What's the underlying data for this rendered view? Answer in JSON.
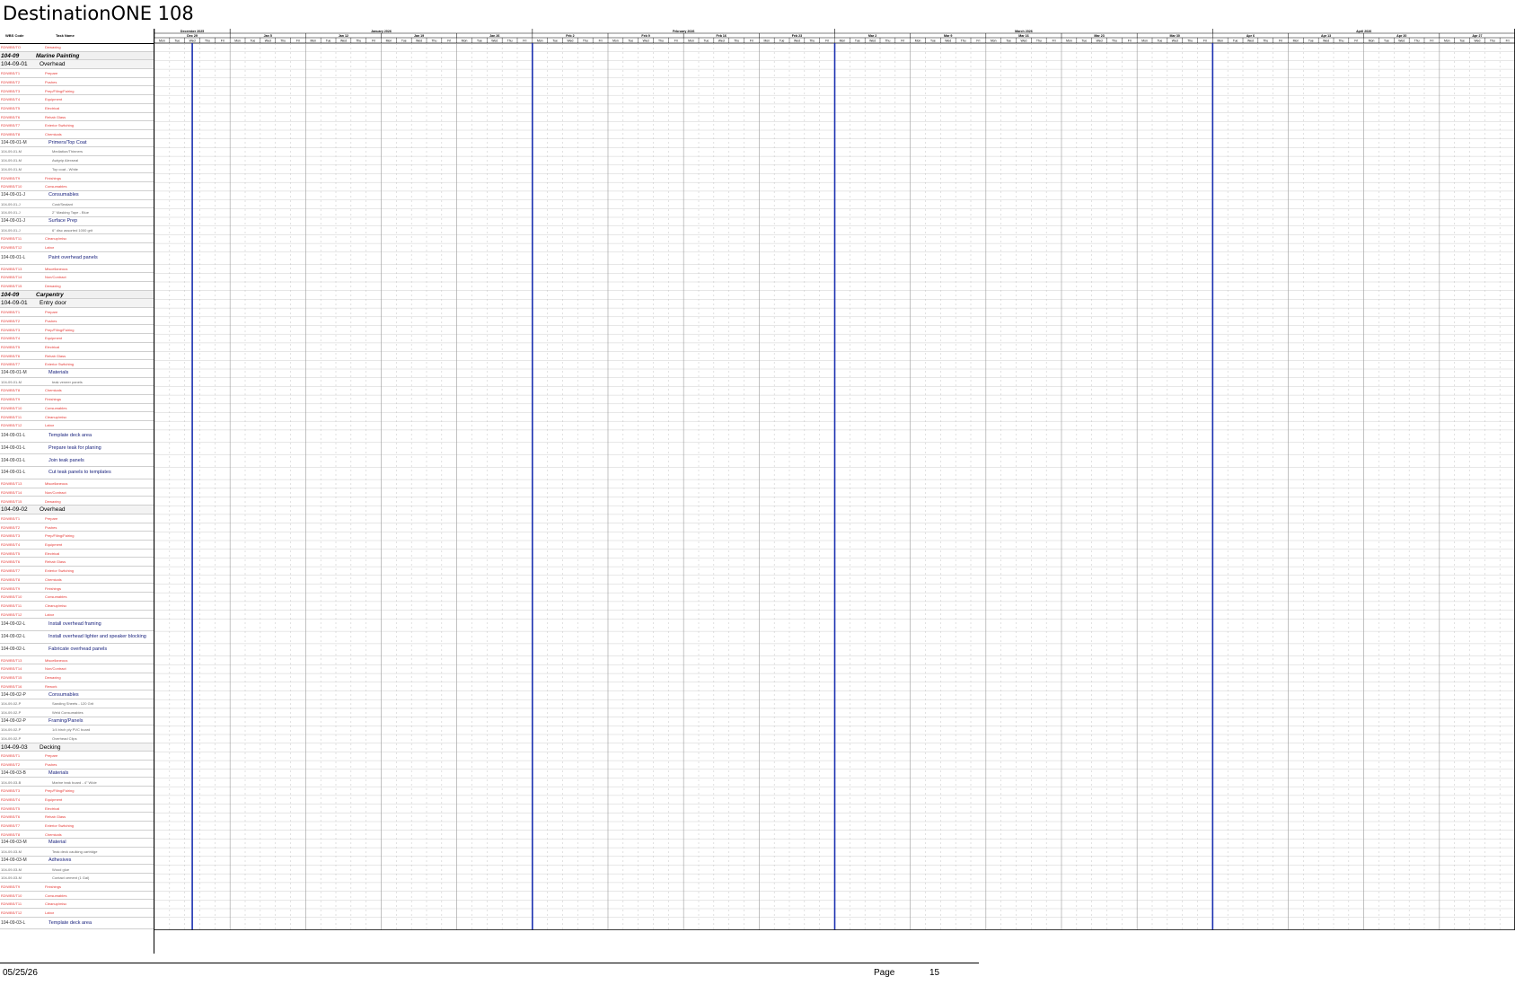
{
  "title": "DestinationONE 108",
  "table": {
    "col_code": "WBS Code",
    "col_name": "Task Name",
    "rows": [
      {
        "t": "red",
        "c": "R2/WBS/TO",
        "n": "Dewaxing"
      },
      {
        "t": "h1",
        "c": "104-09",
        "n": "Marine Painting"
      },
      {
        "t": "h2",
        "c": "104-09-01",
        "n": "Overhead"
      },
      {
        "t": "red",
        "c": "R2/WBS/T1",
        "n": "Prepare"
      },
      {
        "t": "red",
        "c": "R2/WBS/T2",
        "n": "Pushes"
      },
      {
        "t": "red",
        "c": "R2/WBS/T3",
        "n": "Prep/Filing/Fairing"
      },
      {
        "t": "red",
        "c": "R2/WBS/T4",
        "n": "Equipment"
      },
      {
        "t": "red",
        "c": "R2/WBS/T5",
        "n": "Electrical"
      },
      {
        "t": "red",
        "c": "R2/WBS/T6",
        "n": "Rehab Glass"
      },
      {
        "t": "red",
        "c": "R2/WBS/T7",
        "n": "Exterior Switching"
      },
      {
        "t": "red",
        "c": "R2/WBS/T8",
        "n": "Chemicals"
      },
      {
        "t": "sub",
        "c": "104-09-01-M",
        "n": "Primers/Top Coat"
      },
      {
        "t": "mat",
        "c": "104-09-01-M",
        "n": "Mediation/Thinners"
      },
      {
        "t": "mat",
        "c": "104-09-01-M",
        "n": "Awlgrip Alexseal"
      },
      {
        "t": "mat",
        "c": "104-09-01-M",
        "n": "Top coat - White"
      },
      {
        "t": "red",
        "c": "R2/WBS/T9",
        "n": "Finishings"
      },
      {
        "t": "red",
        "c": "R2/WBS/T10",
        "n": "Consumables"
      },
      {
        "t": "sub",
        "c": "104-09-01-J",
        "n": "Consumables"
      },
      {
        "t": "mat",
        "c": "104-09-01-J",
        "n": "Cost/Sealant"
      },
      {
        "t": "mat",
        "c": "104-09-01-J",
        "n": "2\" Masking Tape - Blue"
      },
      {
        "t": "sub",
        "c": "104-09-01-J",
        "n": "Surface Prep"
      },
      {
        "t": "mat",
        "c": "104-09-01-J",
        "n": "6\" disc assorted 1000 grit"
      },
      {
        "t": "red",
        "c": "R2/WBS/T11",
        "n": "Cleanup/misc"
      },
      {
        "t": "red",
        "c": "R2/WBS/T12",
        "n": "Labor"
      },
      {
        "t": "task",
        "c": "104-09-01-L",
        "n": "Paint overhead panels"
      },
      {
        "t": "red",
        "c": "R2/WBS/T13",
        "n": "Miscellaneous"
      },
      {
        "t": "red",
        "c": "R2/WBS/T14",
        "n": "Non/Contract"
      },
      {
        "t": "red",
        "c": "R2/WBS/T15",
        "n": "Dewaxing"
      },
      {
        "t": "h1",
        "c": "104-09",
        "n": "Carpentry"
      },
      {
        "t": "h2",
        "c": "104-09-01",
        "n": "Entry door"
      },
      {
        "t": "red",
        "c": "R2/WBS/T1",
        "n": "Prepare"
      },
      {
        "t": "red",
        "c": "R2/WBS/T2",
        "n": "Pushes"
      },
      {
        "t": "red",
        "c": "R2/WBS/T3",
        "n": "Prep/Filing/Fairing"
      },
      {
        "t": "red",
        "c": "R2/WBS/T4",
        "n": "Equipment"
      },
      {
        "t": "red",
        "c": "R2/WBS/T5",
        "n": "Electrical"
      },
      {
        "t": "red",
        "c": "R2/WBS/T6",
        "n": "Rehab Glass"
      },
      {
        "t": "red",
        "c": "R2/WBS/T7",
        "n": "Exterior Switching"
      },
      {
        "t": "sub",
        "c": "104-09-01-M",
        "n": "Materials"
      },
      {
        "t": "mat",
        "c": "104-09-01-M",
        "n": "teak veneer panels"
      },
      {
        "t": "red",
        "c": "R2/WBS/T8",
        "n": "Chemicals"
      },
      {
        "t": "red",
        "c": "R2/WBS/T9",
        "n": "Finishings"
      },
      {
        "t": "red",
        "c": "R2/WBS/T10",
        "n": "Consumables"
      },
      {
        "t": "red",
        "c": "R2/WBS/T11",
        "n": "Cleanup/misc"
      },
      {
        "t": "red",
        "c": "R2/WBS/T12",
        "n": "Labor"
      },
      {
        "t": "task",
        "c": "104-09-01-L",
        "n": "Template deck area"
      },
      {
        "t": "task",
        "c": "104-09-01-L",
        "n": "Prepare teak for planing"
      },
      {
        "t": "task",
        "c": "104-09-01-L",
        "n": "Join teak panels"
      },
      {
        "t": "task",
        "c": "104-09-01-L",
        "n": "Cut teak panels to templates"
      },
      {
        "t": "red",
        "c": "R2/WBS/T13",
        "n": "Miscellaneous"
      },
      {
        "t": "red",
        "c": "R2/WBS/T14",
        "n": "Non/Contract"
      },
      {
        "t": "red",
        "c": "R2/WBS/T15",
        "n": "Dewaxing"
      },
      {
        "t": "h2",
        "c": "104-09-02",
        "n": "Overhead"
      },
      {
        "t": "red",
        "c": "R2/WBS/T1",
        "n": "Prepare"
      },
      {
        "t": "red",
        "c": "R2/WBS/T2",
        "n": "Pushes"
      },
      {
        "t": "red",
        "c": "R2/WBS/T3",
        "n": "Prep/Filing/Fairing"
      },
      {
        "t": "red",
        "c": "R2/WBS/T4",
        "n": "Equipment"
      },
      {
        "t": "red",
        "c": "R2/WBS/T5",
        "n": "Electrical"
      },
      {
        "t": "red",
        "c": "R2/WBS/T6",
        "n": "Rehab Glass"
      },
      {
        "t": "red",
        "c": "R2/WBS/T7",
        "n": "Exterior Switching"
      },
      {
        "t": "red",
        "c": "R2/WBS/T8",
        "n": "Chemicals"
      },
      {
        "t": "red",
        "c": "R2/WBS/T9",
        "n": "Finishings"
      },
      {
        "t": "red",
        "c": "R2/WBS/T10",
        "n": "Consumables"
      },
      {
        "t": "red",
        "c": "R2/WBS/T11",
        "n": "Cleanup/misc"
      },
      {
        "t": "red",
        "c": "R2/WBS/T12",
        "n": "Labor"
      },
      {
        "t": "task",
        "c": "104-09-02-L",
        "n": "Install overhead framing"
      },
      {
        "t": "task",
        "c": "104-09-02-L",
        "n": "Install overhead lighter and speaker blocking"
      },
      {
        "t": "task",
        "c": "104-09-02-L",
        "n": "Fabricate overhead panels"
      },
      {
        "t": "red",
        "c": "R2/WBS/T13",
        "n": "Miscellaneous"
      },
      {
        "t": "red",
        "c": "R2/WBS/T14",
        "n": "Non/Contract"
      },
      {
        "t": "red",
        "c": "R2/WBS/T15",
        "n": "Dewaxing"
      },
      {
        "t": "red",
        "c": "R2/WBS/T16",
        "n": "Rework"
      },
      {
        "t": "sub",
        "c": "104-09-02-P",
        "n": "Consumables"
      },
      {
        "t": "mat",
        "c": "104-09-02-P",
        "n": "Sanding Sheets - 120 Grit"
      },
      {
        "t": "mat",
        "c": "104-09-02-P",
        "n": "Weld Consumables"
      },
      {
        "t": "sub",
        "c": "104-09-02-P",
        "n": "Framing/Panels"
      },
      {
        "t": "mat",
        "c": "104-09-02-P",
        "n": "1/4 birch ply PVC board"
      },
      {
        "t": "mat",
        "c": "104-09-02-P",
        "n": "Overhead Clips"
      },
      {
        "t": "h2",
        "c": "104-09-03",
        "n": "Decking"
      },
      {
        "t": "red",
        "c": "R2/WBS/T1",
        "n": "Prepare"
      },
      {
        "t": "red",
        "c": "R2/WBS/T2",
        "n": "Pushes"
      },
      {
        "t": "sub",
        "c": "104-09-03-B",
        "n": "Materials"
      },
      {
        "t": "mat",
        "c": "104-09-03-B",
        "n": "Marine teak board - 4\" Wide"
      },
      {
        "t": "red",
        "c": "R2/WBS/T3",
        "n": "Prep/Filing/Fairing"
      },
      {
        "t": "red",
        "c": "R2/WBS/T4",
        "n": "Equipment"
      },
      {
        "t": "red",
        "c": "R2/WBS/T5",
        "n": "Electrical"
      },
      {
        "t": "red",
        "c": "R2/WBS/T6",
        "n": "Rehab Glass"
      },
      {
        "t": "red",
        "c": "R2/WBS/T7",
        "n": "Exterior Switching"
      },
      {
        "t": "red",
        "c": "R2/WBS/T8",
        "n": "Chemicals"
      },
      {
        "t": "sub",
        "c": "104-09-03-M",
        "n": "Material"
      },
      {
        "t": "mat",
        "c": "104-09-03-M",
        "n": "Teak deck caulking cartridge"
      },
      {
        "t": "sub",
        "c": "104-09-03-M",
        "n": "Adhesives"
      },
      {
        "t": "mat",
        "c": "104-09-03-M",
        "n": "Wood glue"
      },
      {
        "t": "mat",
        "c": "104-09-03-M",
        "n": "Contact cement (1 Gal)"
      },
      {
        "t": "red",
        "c": "R2/WBS/T9",
        "n": "Finishings"
      },
      {
        "t": "red",
        "c": "R2/WBS/T10",
        "n": "Consumables"
      },
      {
        "t": "red",
        "c": "R2/WBS/T11",
        "n": "Cleanup/misc"
      },
      {
        "t": "red",
        "c": "R2/WBS/T12",
        "n": "Labor"
      },
      {
        "t": "task",
        "c": "104-09-03-L",
        "n": "Template deck area"
      }
    ]
  },
  "calendar": {
    "months": [
      "December 2025",
      "January 2026",
      "February 2026",
      "March 2026",
      "April 2026"
    ],
    "weeks": [
      "Dec 29",
      "Jan 5",
      "Jan 12",
      "Jan 19",
      "Jan 26",
      "Feb 2",
      "Feb 9",
      "Feb 16",
      "Feb 23",
      "Mar 2",
      "Mar 9",
      "Mar 16",
      "Mar 23",
      "Mar 30",
      "Apr 6",
      "Apr 13",
      "Apr 20",
      "Apr 27"
    ],
    "days": [
      "Mon",
      "Tue",
      "Wed",
      "Thu",
      "Fri"
    ],
    "separator_color": "#1a2fb0"
  },
  "footer": {
    "date": "05/25/26",
    "page_label": "Page",
    "page_number": "15"
  }
}
